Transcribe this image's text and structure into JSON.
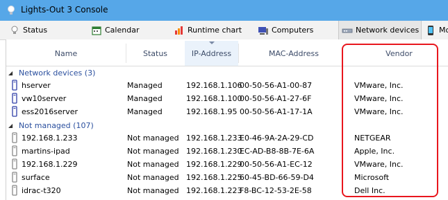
{
  "window": {
    "title": "Lights-Out 3 Console"
  },
  "tabs": [
    {
      "label": "Status",
      "icon": "lightbulb-icon"
    },
    {
      "label": "Calendar",
      "icon": "calendar-icon"
    },
    {
      "label": "Runtime chart",
      "icon": "chart-icon"
    },
    {
      "label": "Computers",
      "icon": "computer-icon"
    },
    {
      "label": "Network devices",
      "icon": "network-icon",
      "active": true
    },
    {
      "label": "Mo",
      "icon": "mobile-icon"
    }
  ],
  "columns": [
    "Name",
    "Status",
    "IP-Address",
    "MAC-Address",
    "Vendor"
  ],
  "groups": [
    {
      "label": "Network devices (3)",
      "rows": [
        {
          "name": "hserver",
          "status": "Managed",
          "ip": "192.168.1.106",
          "mac": "00-50-56-A1-00-87",
          "vendor": "VMware, Inc."
        },
        {
          "name": "vw10server",
          "status": "Managed",
          "ip": "192.168.1.100",
          "mac": "00-50-56-A1-27-6F",
          "vendor": "VMware, Inc."
        },
        {
          "name": "ess2016server",
          "status": "Managed",
          "ip": "192.168.1.95",
          "mac": "00-50-56-A1-17-1A",
          "vendor": "VMware, Inc."
        }
      ]
    },
    {
      "label": "Not managed (107)",
      "rows": [
        {
          "name": "192.168.1.233",
          "status": "Not managed",
          "ip": "192.168.1.233",
          "mac": "E0-46-9A-2A-29-CD",
          "vendor": "NETGEAR"
        },
        {
          "name": "martins-ipad",
          "status": "Not managed",
          "ip": "192.168.1.230",
          "mac": "EC-AD-B8-8B-7E-6A",
          "vendor": "Apple, Inc."
        },
        {
          "name": "192.168.1.229",
          "status": "Not managed",
          "ip": "192.168.1.229",
          "mac": "00-50-56-A1-EC-12",
          "vendor": "VMware, Inc."
        },
        {
          "name": "surface",
          "status": "Not managed",
          "ip": "192.168.1.225",
          "mac": "60-45-BD-66-59-D4",
          "vendor": "Microsoft"
        },
        {
          "name": "idrac-t320",
          "status": "Not managed",
          "ip": "192.168.1.223",
          "mac": "F8-BC-12-53-2E-58",
          "vendor": "Dell Inc."
        }
      ]
    }
  ],
  "colors": {
    "titlebar": "#56a7e8",
    "group_text": "#2a4f9e",
    "highlight": "#e8161d"
  }
}
